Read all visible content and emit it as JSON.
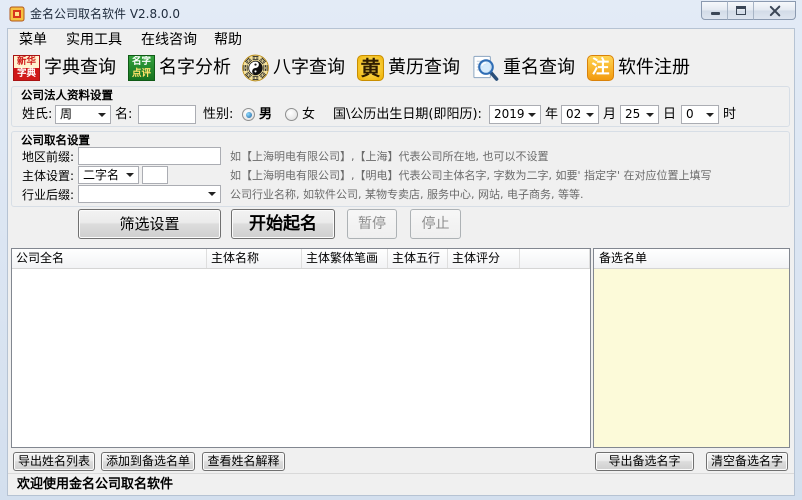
{
  "window": {
    "title": "金名公司取名软件 V2.8.0.0",
    "app_icon": "app-logo-icon"
  },
  "menu": [
    {
      "label": "菜单"
    },
    {
      "label": "实用工具"
    },
    {
      "label": "在线咨询"
    },
    {
      "label": "帮助"
    }
  ],
  "toolbar": [
    {
      "label": "字典查询",
      "icon": "dictionary-icon",
      "icon_text": [
        "新华",
        "字典"
      ]
    },
    {
      "label": "名字分析",
      "icon": "name-review-icon",
      "icon_text": [
        "名字",
        "点评"
      ]
    },
    {
      "label": "八字查询",
      "icon": "bagua-icon"
    },
    {
      "label": "黄历查询",
      "icon": "almanac-icon",
      "icon_text": [
        "黄"
      ]
    },
    {
      "label": "重名查询",
      "icon": "magnifier-icon"
    },
    {
      "label": "软件注册",
      "icon": "register-icon",
      "icon_text": [
        "注"
      ]
    }
  ],
  "legal_person": {
    "title": "公司法人资料设置",
    "surname_label": "姓氏:",
    "surname_value": "周",
    "given_name_label": "名:",
    "given_name_value": "",
    "gender_label": "性别:",
    "gender_options": [
      "男",
      "女"
    ],
    "gender_selected": "男",
    "birth_label": "国\\公历出生日期(即阳历):",
    "year": "2019",
    "year_unit": "年",
    "month": "02",
    "month_unit": "月",
    "day": "25",
    "day_unit": "日",
    "hour": "0",
    "hour_unit": "时"
  },
  "naming": {
    "title": "公司取名设置",
    "region_label": "地区前缀:",
    "region_value": "",
    "region_hint": "如【上海明电有限公司】,【上海】代表公司所在地, 也可以不设置",
    "main_label": "主体设置:",
    "main_value": "二字名",
    "main_fixed_chars": "",
    "main_hint": "如【上海明电有限公司】,【明电】代表公司主体名字, 字数为二字, 如要' 指定字' 在对应位置上填写",
    "industry_label": "行业后缀:",
    "industry_value": "",
    "industry_hint": "公司行业名称, 如软件公司, 某物专卖店, 服务中心, 网站, 电子商务, 等等."
  },
  "actions": {
    "filter": {
      "label": "筛选设置",
      "enabled": true
    },
    "start": {
      "label": "开始起名",
      "enabled": true
    },
    "pause": {
      "label": "暂停",
      "enabled": false
    },
    "stop": {
      "label": "停止",
      "enabled": false
    }
  },
  "results_table": {
    "columns": [
      "公司全名",
      "主体名称",
      "主体繁体笔画",
      "主体五行",
      "主体评分"
    ],
    "rows": []
  },
  "shortlist": {
    "title": "备选名单",
    "items": []
  },
  "bottom_buttons": {
    "export_list": "导出姓名列表",
    "add_to_shortlist": "添加到备选名单",
    "view_explanation": "查看姓名解释",
    "export_shortlist": "导出备选名字",
    "clear_shortlist": "清空备选名字"
  },
  "status": "欢迎使用金名公司取名软件",
  "colors": {
    "client_background": "#f0f0f0",
    "shortlist_background": "#fcfad9",
    "hint_text": "#6b6b6b",
    "disabled_text": "#8d8d8d"
  }
}
